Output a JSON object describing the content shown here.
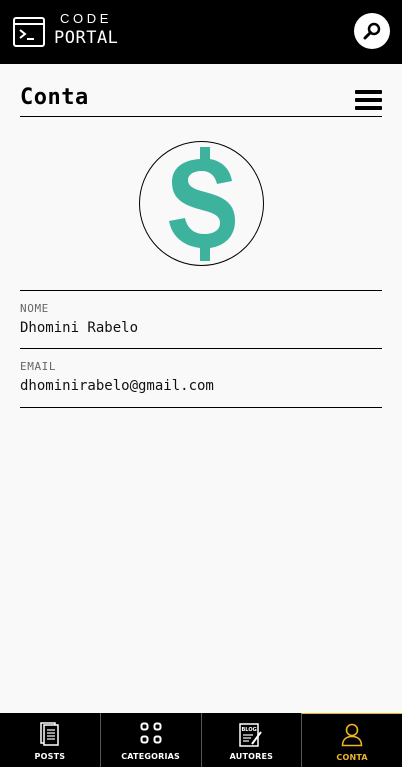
{
  "header": {
    "brand_top": "CODE",
    "brand_bottom": "PORTAL"
  },
  "page": {
    "title": "Conta"
  },
  "profile": {
    "avatar_icon": "dollar-sign-icon",
    "avatar_color": "#3db39e",
    "fields": [
      {
        "label": "NOME",
        "value": "Dhomini Rabelo"
      },
      {
        "label": "EMAIL",
        "value": "dhominirabelo@gmail.com"
      }
    ]
  },
  "nav": {
    "active_color": "#f0b429",
    "items": [
      {
        "label": "POSTS",
        "icon": "document-icon"
      },
      {
        "label": "CATEGORIAS",
        "icon": "grid-icon"
      },
      {
        "label": "AUTORES",
        "icon": "blog-icon",
        "icon_text": "BLOG"
      },
      {
        "label": "CONTA",
        "icon": "user-icon",
        "active": true
      }
    ]
  }
}
